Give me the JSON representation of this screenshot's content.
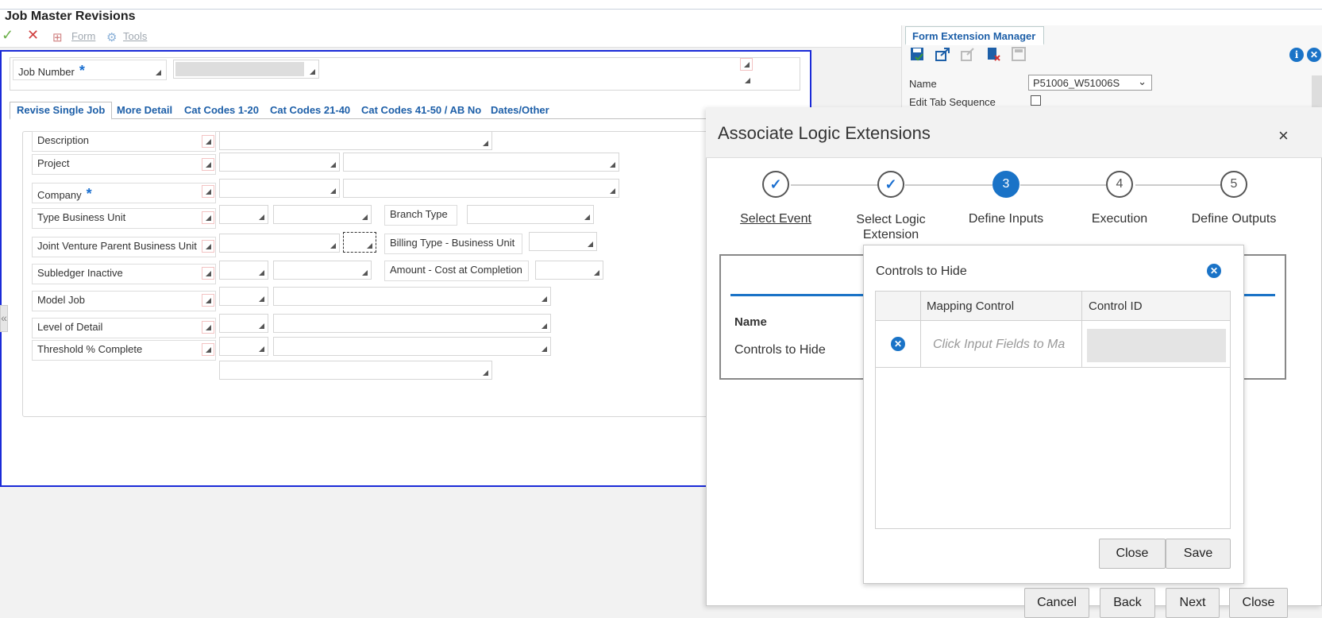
{
  "window": {
    "title": "Job Master Revisions"
  },
  "toolbar": {
    "form_label": "Form",
    "tools_label": "Tools"
  },
  "header": {
    "job_number_label": "Job Number",
    "required_mark": "*"
  },
  "tabs": [
    {
      "label": "Revise Single Job"
    },
    {
      "label": "More Detail"
    },
    {
      "label": "Cat Codes 1-20"
    },
    {
      "label": "Cat Codes 21-40"
    },
    {
      "label": "Cat Codes 41-50 / AB No"
    },
    {
      "label": "Dates/Other"
    }
  ],
  "fields": {
    "description": "Description",
    "project": "Project",
    "company": "Company",
    "type_bu": "Type Business Unit",
    "branch_type": "Branch Type",
    "jv_parent": "Joint Venture Parent Business Unit",
    "billing_type": "Billing Type - Business Unit",
    "subledger_inactive": "Subledger Inactive",
    "amount_cost": "Amount - Cost at Completion",
    "model_job": "Model Job",
    "level_of_detail": "Level of Detail",
    "threshold": "Threshold % Complete"
  },
  "fem": {
    "tab_label": "Form Extension Manager",
    "name_label": "Name",
    "name_value": "P51006_W51006S",
    "edit_tab_label": "Edit Tab Sequence"
  },
  "modal": {
    "title": "Associate Logic Extensions",
    "close_glyph": "×",
    "steps": [
      {
        "num": "✓",
        "label": "Select Event"
      },
      {
        "num": "✓",
        "label": "Select Logic Extension"
      },
      {
        "num": "3",
        "label": "Define Inputs"
      },
      {
        "num": "4",
        "label": "Execution"
      },
      {
        "num": "5",
        "label": "Define Outputs"
      }
    ],
    "name_header": "Name",
    "controls_to_hide_row": "Controls to Hide",
    "footer": {
      "cancel": "Cancel",
      "back": "Back",
      "next": "Next",
      "close": "Close"
    }
  },
  "popup": {
    "title": "Controls to Hide",
    "col_mapping": "Mapping Control",
    "col_control_id": "Control ID",
    "mapping_placeholder": "Click Input Fields to Ma",
    "close": "Close",
    "save": "Save"
  },
  "colors": {
    "accent": "#1a73c7",
    "form_border": "#1a2ad8",
    "tab_text": "#1d5fa8"
  }
}
